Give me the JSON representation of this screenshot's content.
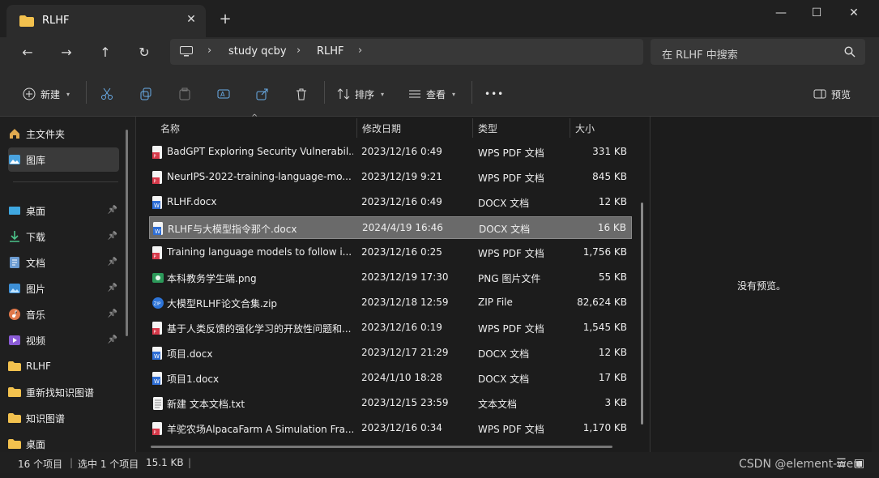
{
  "tab": {
    "title": "RLHF",
    "close_icon": "close-icon",
    "new_tab": "+"
  },
  "window": {
    "minimize": "—",
    "maximize": "☐",
    "close": "✕"
  },
  "address": {
    "crumbs": [
      "study qcby",
      "RLHF"
    ],
    "search_placeholder": "在 RLHF 中搜索"
  },
  "toolbar": {
    "new_label": "新建",
    "sort_label": "排序",
    "view_label": "查看",
    "more_label": "•••",
    "preview_label": "预览"
  },
  "sidebar": {
    "items": [
      {
        "label": "主文件夹",
        "icon": "home-icon",
        "pinned": false
      },
      {
        "label": "图库",
        "icon": "gallery-icon",
        "pinned": false,
        "selected": true
      },
      {
        "label": "桌面",
        "icon": "desktop-icon",
        "pinned": true
      },
      {
        "label": "下载",
        "icon": "download-icon",
        "pinned": true
      },
      {
        "label": "文档",
        "icon": "document-icon",
        "pinned": true
      },
      {
        "label": "图片",
        "icon": "picture-icon",
        "pinned": true
      },
      {
        "label": "音乐",
        "icon": "music-icon",
        "pinned": true
      },
      {
        "label": "视频",
        "icon": "video-icon",
        "pinned": true
      },
      {
        "label": "RLHF",
        "icon": "folder-icon",
        "pinned": false
      },
      {
        "label": "重新找知识图谱",
        "icon": "folder-icon",
        "pinned": false
      },
      {
        "label": "知识图谱",
        "icon": "folder-icon",
        "pinned": false
      },
      {
        "label": "桌面",
        "icon": "folder-icon",
        "pinned": false
      }
    ]
  },
  "columns": {
    "name": "名称",
    "date": "修改日期",
    "type": "类型",
    "size": "大小"
  },
  "files": [
    {
      "name": "BadGPT Exploring Security Vulnerabil...",
      "date": "2023/12/16 0:49",
      "type": "WPS PDF 文档",
      "size": "331 KB",
      "icon": "pdf"
    },
    {
      "name": "NeurIPS-2022-training-language-mo...",
      "date": "2023/12/19 9:21",
      "type": "WPS PDF 文档",
      "size": "845 KB",
      "icon": "pdf"
    },
    {
      "name": "RLHF.docx",
      "date": "2023/12/16 0:49",
      "type": "DOCX 文档",
      "size": "12 KB",
      "icon": "docx"
    },
    {
      "name": "RLHF与大模型指令那个.docx",
      "date": "2024/4/19 16:46",
      "type": "DOCX 文档",
      "size": "16 KB",
      "icon": "docx",
      "selected": true
    },
    {
      "name": "Training language models to follow i...",
      "date": "2023/12/16 0:25",
      "type": "WPS PDF 文档",
      "size": "1,756 KB",
      "icon": "pdf"
    },
    {
      "name": "本科教务学生端.png",
      "date": "2023/12/19 17:30",
      "type": "PNG 图片文件",
      "size": "55 KB",
      "icon": "png"
    },
    {
      "name": "大模型RLHF论文合集.zip",
      "date": "2023/12/18 12:59",
      "type": "ZIP File",
      "size": "82,624 KB",
      "icon": "zip"
    },
    {
      "name": "基于人类反馈的强化学习的开放性问题和...",
      "date": "2023/12/16 0:19",
      "type": "WPS PDF 文档",
      "size": "1,545 KB",
      "icon": "pdf"
    },
    {
      "name": "项目.docx",
      "date": "2023/12/17 21:29",
      "type": "DOCX 文档",
      "size": "12 KB",
      "icon": "docx"
    },
    {
      "name": "项目1.docx",
      "date": "2024/1/10 18:28",
      "type": "DOCX 文档",
      "size": "17 KB",
      "icon": "docx"
    },
    {
      "name": "新建 文本文档.txt",
      "date": "2023/12/15 23:59",
      "type": "文本文档",
      "size": "3 KB",
      "icon": "txt"
    },
    {
      "name": "羊驼农场AlpacaFarm A Simulation Fra...",
      "date": "2023/12/16 0:34",
      "type": "WPS PDF 文档",
      "size": "1,170 KB",
      "icon": "pdf"
    }
  ],
  "preview": {
    "message": "没有预览。"
  },
  "status": {
    "count": "16 个项目",
    "selection": "选中 1 个项目",
    "size": "15.1 KB"
  },
  "watermark": "CSDN @element-wen",
  "colors": {
    "pdf": "#d6394a",
    "docx": "#2f6fd6",
    "folder": "#f2c14e",
    "selection": "#6a6a6a"
  }
}
